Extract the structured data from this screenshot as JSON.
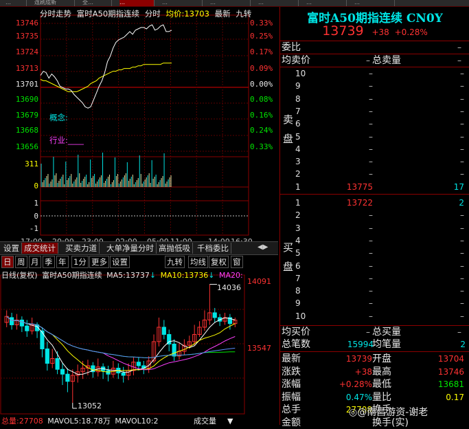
{
  "top_tabs": [
    "…",
    "连刷成新",
    "全…",
    "…",
    "…",
    "…",
    "…",
    "…",
    "…"
  ],
  "intraday": {
    "header": {
      "label": "分时走势",
      "name": "富时A50期指连续",
      "mode": "分时",
      "avg_label": "均价:",
      "avg_value": "13703",
      "latest_label": "最新",
      "nine_turn": "九转"
    },
    "price_ticks": [
      "13746",
      "13735",
      "13724",
      "13713",
      "13701",
      "13690",
      "13679",
      "13668",
      "13656"
    ],
    "pct_ticks": [
      "0.33%",
      "0.25%",
      "0.17%",
      "0.09%",
      "0.00%",
      "0.08%",
      "0.16%",
      "0.24%",
      "0.33%"
    ],
    "concept_label": "概念:",
    "industry_label": "行业:",
    "industry_value": "____",
    "vol_ticks": [
      "311",
      "0"
    ],
    "sub_ticks": [
      "1",
      "0",
      "-1"
    ],
    "time_ticks": [
      "17:00",
      "20:00",
      "23:00",
      "02:00",
      "05:00",
      "11:00",
      "14:00",
      "16:30"
    ],
    "price_series": [
      13708,
      13711,
      13710,
      13706,
      13709,
      13707,
      13704,
      13700,
      13699,
      13698,
      13698,
      13697,
      13694,
      13692,
      13690,
      13688,
      13685,
      13684,
      13685,
      13690,
      13695,
      13700,
      13704,
      13710,
      13718,
      13722,
      13728,
      13732,
      13734,
      13735,
      13736,
      13738,
      13740,
      13738,
      13741,
      13742,
      13743,
      13743,
      13742,
      13744,
      13745,
      13741,
      13742,
      13744,
      13745,
      13740,
      13740,
      13741
    ],
    "avg_series": [
      13705,
      13704,
      13704,
      13703,
      13702,
      13701,
      13700,
      13699,
      13698,
      13697,
      13696,
      13696,
      13696,
      13696,
      13697,
      13698,
      13699,
      13700,
      13702,
      13703,
      13704,
      13706,
      13707,
      13708,
      13709,
      13710,
      13711,
      13711,
      13712,
      13712,
      13713,
      13713,
      13713,
      13714,
      13714,
      13715,
      13715,
      13716,
      13716,
      13716,
      13716,
      13716,
      13716,
      13716,
      13717,
      13717,
      13717,
      13717
    ]
  },
  "function_tabs": [
    "设置",
    "成交统计",
    "买卖力道",
    "大单净量分时",
    "高抛低吸",
    "千档委比"
  ],
  "period_tabs": [
    "日",
    "周",
    "月",
    "季",
    "年",
    "1分",
    "更多",
    "设置",
    "九转",
    "均线",
    "复权",
    "窗"
  ],
  "kline": {
    "header": {
      "mode": "日线(复权)",
      "name": "富时A50期指连续",
      "ma5_label": "MA5:",
      "ma5": "13737",
      "ma10_label": "MA10:",
      "ma10": "13736",
      "ma20_label": "MA20:"
    },
    "high_label": "14036",
    "low_label": "13052",
    "right_ticks": [
      "14091",
      "13547"
    ],
    "candles": [
      {
        "o": 13720,
        "c": 13770,
        "h": 13820,
        "l": 13680
      },
      {
        "o": 13760,
        "c": 13700,
        "h": 13800,
        "l": 13660
      },
      {
        "o": 13700,
        "c": 13740,
        "h": 13790,
        "l": 13660
      },
      {
        "o": 13740,
        "c": 13690,
        "h": 13770,
        "l": 13640
      },
      {
        "o": 13690,
        "c": 13650,
        "h": 13740,
        "l": 13600
      },
      {
        "o": 13650,
        "c": 13700,
        "h": 13760,
        "l": 13620
      },
      {
        "o": 13700,
        "c": 13650,
        "h": 13720,
        "l": 13590
      },
      {
        "o": 13650,
        "c": 13500,
        "h": 13680,
        "l": 13430
      },
      {
        "o": 13500,
        "c": 13380,
        "h": 13560,
        "l": 13320
      },
      {
        "o": 13380,
        "c": 13420,
        "h": 13500,
        "l": 13340
      },
      {
        "o": 13420,
        "c": 13330,
        "h": 13480,
        "l": 13290
      },
      {
        "o": 13330,
        "c": 13290,
        "h": 13380,
        "l": 13200
      },
      {
        "o": 13290,
        "c": 13230,
        "h": 13340,
        "l": 13140
      },
      {
        "o": 13230,
        "c": 13280,
        "h": 13330,
        "l": 13052
      },
      {
        "o": 13280,
        "c": 13310,
        "h": 13370,
        "l": 13220
      },
      {
        "o": 13310,
        "c": 13340,
        "h": 13400,
        "l": 13250
      },
      {
        "o": 13340,
        "c": 13360,
        "h": 13410,
        "l": 13280
      },
      {
        "o": 13360,
        "c": 13310,
        "h": 13390,
        "l": 13260
      },
      {
        "o": 13310,
        "c": 13350,
        "h": 13420,
        "l": 13270
      },
      {
        "o": 13350,
        "c": 13320,
        "h": 13380,
        "l": 13250
      },
      {
        "o": 13320,
        "c": 13290,
        "h": 13360,
        "l": 13230
      },
      {
        "o": 13290,
        "c": 13340,
        "h": 13400,
        "l": 13260
      },
      {
        "o": 13340,
        "c": 13300,
        "h": 13380,
        "l": 13250
      },
      {
        "o": 13300,
        "c": 13280,
        "h": 13350,
        "l": 13220
      },
      {
        "o": 13280,
        "c": 13320,
        "h": 13380,
        "l": 13240
      },
      {
        "o": 13320,
        "c": 13390,
        "h": 13430,
        "l": 13280
      },
      {
        "o": 13390,
        "c": 13360,
        "h": 13430,
        "l": 13320
      },
      {
        "o": 13360,
        "c": 13340,
        "h": 13400,
        "l": 13290
      },
      {
        "o": 13340,
        "c": 13400,
        "h": 13440,
        "l": 13300
      },
      {
        "o": 13400,
        "c": 13560,
        "h": 13620,
        "l": 13380
      },
      {
        "o": 13560,
        "c": 13680,
        "h": 13760,
        "l": 13520
      },
      {
        "o": 13680,
        "c": 13620,
        "h": 13740,
        "l": 13580
      },
      {
        "o": 13620,
        "c": 13540,
        "h": 13660,
        "l": 13480
      },
      {
        "o": 13540,
        "c": 13440,
        "h": 13580,
        "l": 13400
      },
      {
        "o": 13440,
        "c": 13480,
        "h": 13550,
        "l": 13410
      },
      {
        "o": 13480,
        "c": 13530,
        "h": 13580,
        "l": 13450
      },
      {
        "o": 13530,
        "c": 13560,
        "h": 13610,
        "l": 13500
      },
      {
        "o": 13560,
        "c": 13620,
        "h": 13700,
        "l": 13530
      },
      {
        "o": 13620,
        "c": 13680,
        "h": 13730,
        "l": 13600
      },
      {
        "o": 13680,
        "c": 13740,
        "h": 13820,
        "l": 13650
      },
      {
        "o": 13740,
        "c": 13800,
        "h": 14036,
        "l": 13700
      },
      {
        "o": 13800,
        "c": 13760,
        "h": 13840,
        "l": 13720
      },
      {
        "o": 13760,
        "c": 13730,
        "h": 13790,
        "l": 13690
      },
      {
        "o": 13730,
        "c": 13760,
        "h": 13800,
        "l": 13700
      },
      {
        "o": 13760,
        "c": 13710,
        "h": 13790,
        "l": 13660
      },
      {
        "o": 13710,
        "c": 13739,
        "h": 13760,
        "l": 13680
      }
    ],
    "bottom": {
      "vol_label": "总量:",
      "vol": "27708",
      "mavol5_label": "MAVOL5:",
      "mavol5": "18.78万",
      "mavol10_label": "MAVOL10:",
      "mavol10": "2",
      "indicator": "成交量"
    }
  },
  "quote": {
    "title": "富时A50期指连续 CN0Y",
    "price": "13739",
    "change": "+38",
    "change_pct": "+0.28%",
    "weibi_label": "委比",
    "weibi": "–",
    "avg_sell_label": "均卖价",
    "avg_sell": "–",
    "total_sell_label": "总卖量",
    "total_sell": "–",
    "sell_label": "卖盘",
    "sell_levels": [
      {
        "lvl": "10",
        "price": "–",
        "vol": "–"
      },
      {
        "lvl": "9",
        "price": "–",
        "vol": "–"
      },
      {
        "lvl": "8",
        "price": "–",
        "vol": "–"
      },
      {
        "lvl": "7",
        "price": "–",
        "vol": "–"
      },
      {
        "lvl": "6",
        "price": "–",
        "vol": "–"
      },
      {
        "lvl": "5",
        "price": "–",
        "vol": "–"
      },
      {
        "lvl": "4",
        "price": "–",
        "vol": "–"
      },
      {
        "lvl": "3",
        "price": "–",
        "vol": "–"
      },
      {
        "lvl": "2",
        "price": "–",
        "vol": "–"
      },
      {
        "lvl": "1",
        "price": "13775",
        "vol": "17"
      }
    ],
    "buy_label": "买盘",
    "buy_levels": [
      {
        "lvl": "1",
        "price": "13722",
        "vol": "2"
      },
      {
        "lvl": "2",
        "price": "–",
        "vol": "–"
      },
      {
        "lvl": "3",
        "price": "–",
        "vol": "–"
      },
      {
        "lvl": "4",
        "price": "–",
        "vol": "–"
      },
      {
        "lvl": "5",
        "price": "–",
        "vol": "–"
      },
      {
        "lvl": "6",
        "price": "–",
        "vol": "–"
      },
      {
        "lvl": "7",
        "price": "–",
        "vol": "–"
      },
      {
        "lvl": "8",
        "price": "–",
        "vol": "–"
      },
      {
        "lvl": "9",
        "price": "–",
        "vol": "–"
      },
      {
        "lvl": "10",
        "price": "–",
        "vol": "–"
      }
    ],
    "avg_buy_label": "均买价",
    "avg_buy": "–",
    "total_buy_label": "总买量",
    "total_buy": "–",
    "total_trades_label": "总笔数",
    "total_trades": "15994",
    "avg_trade_label": "均笔量",
    "avg_trade": "2",
    "stats": [
      {
        "l1": "最新",
        "v1": "13739",
        "c1": "red",
        "l2": "开盘",
        "v2": "13704",
        "c2": "red"
      },
      {
        "l1": "涨跌",
        "v1": "+38",
        "c1": "red",
        "l2": "最高",
        "v2": "13746",
        "c2": "red"
      },
      {
        "l1": "涨幅",
        "v1": "+0.28%",
        "c1": "red",
        "l2": "最低",
        "v2": "13681",
        "c2": "green"
      },
      {
        "l1": "振幅",
        "v1": "0.47%",
        "c1": "cyan",
        "l2": "量比",
        "v2": "0.17",
        "c2": "yellow"
      },
      {
        "l1": "总手",
        "v1": "27708",
        "c1": "yellow",
        "l2": "换手",
        "v2": "",
        "c2": "white"
      },
      {
        "l1": "金额",
        "v1": "",
        "c1": "white",
        "l2": "换手(实)",
        "v2": "",
        "c2": "white"
      }
    ],
    "watermark": "@南昌游资-谢老"
  },
  "colors": {
    "up": "#ff3232",
    "down": "#00e5e5",
    "grid": "#8c0000",
    "avg": "#ffff00",
    "price": "#ffffff"
  }
}
